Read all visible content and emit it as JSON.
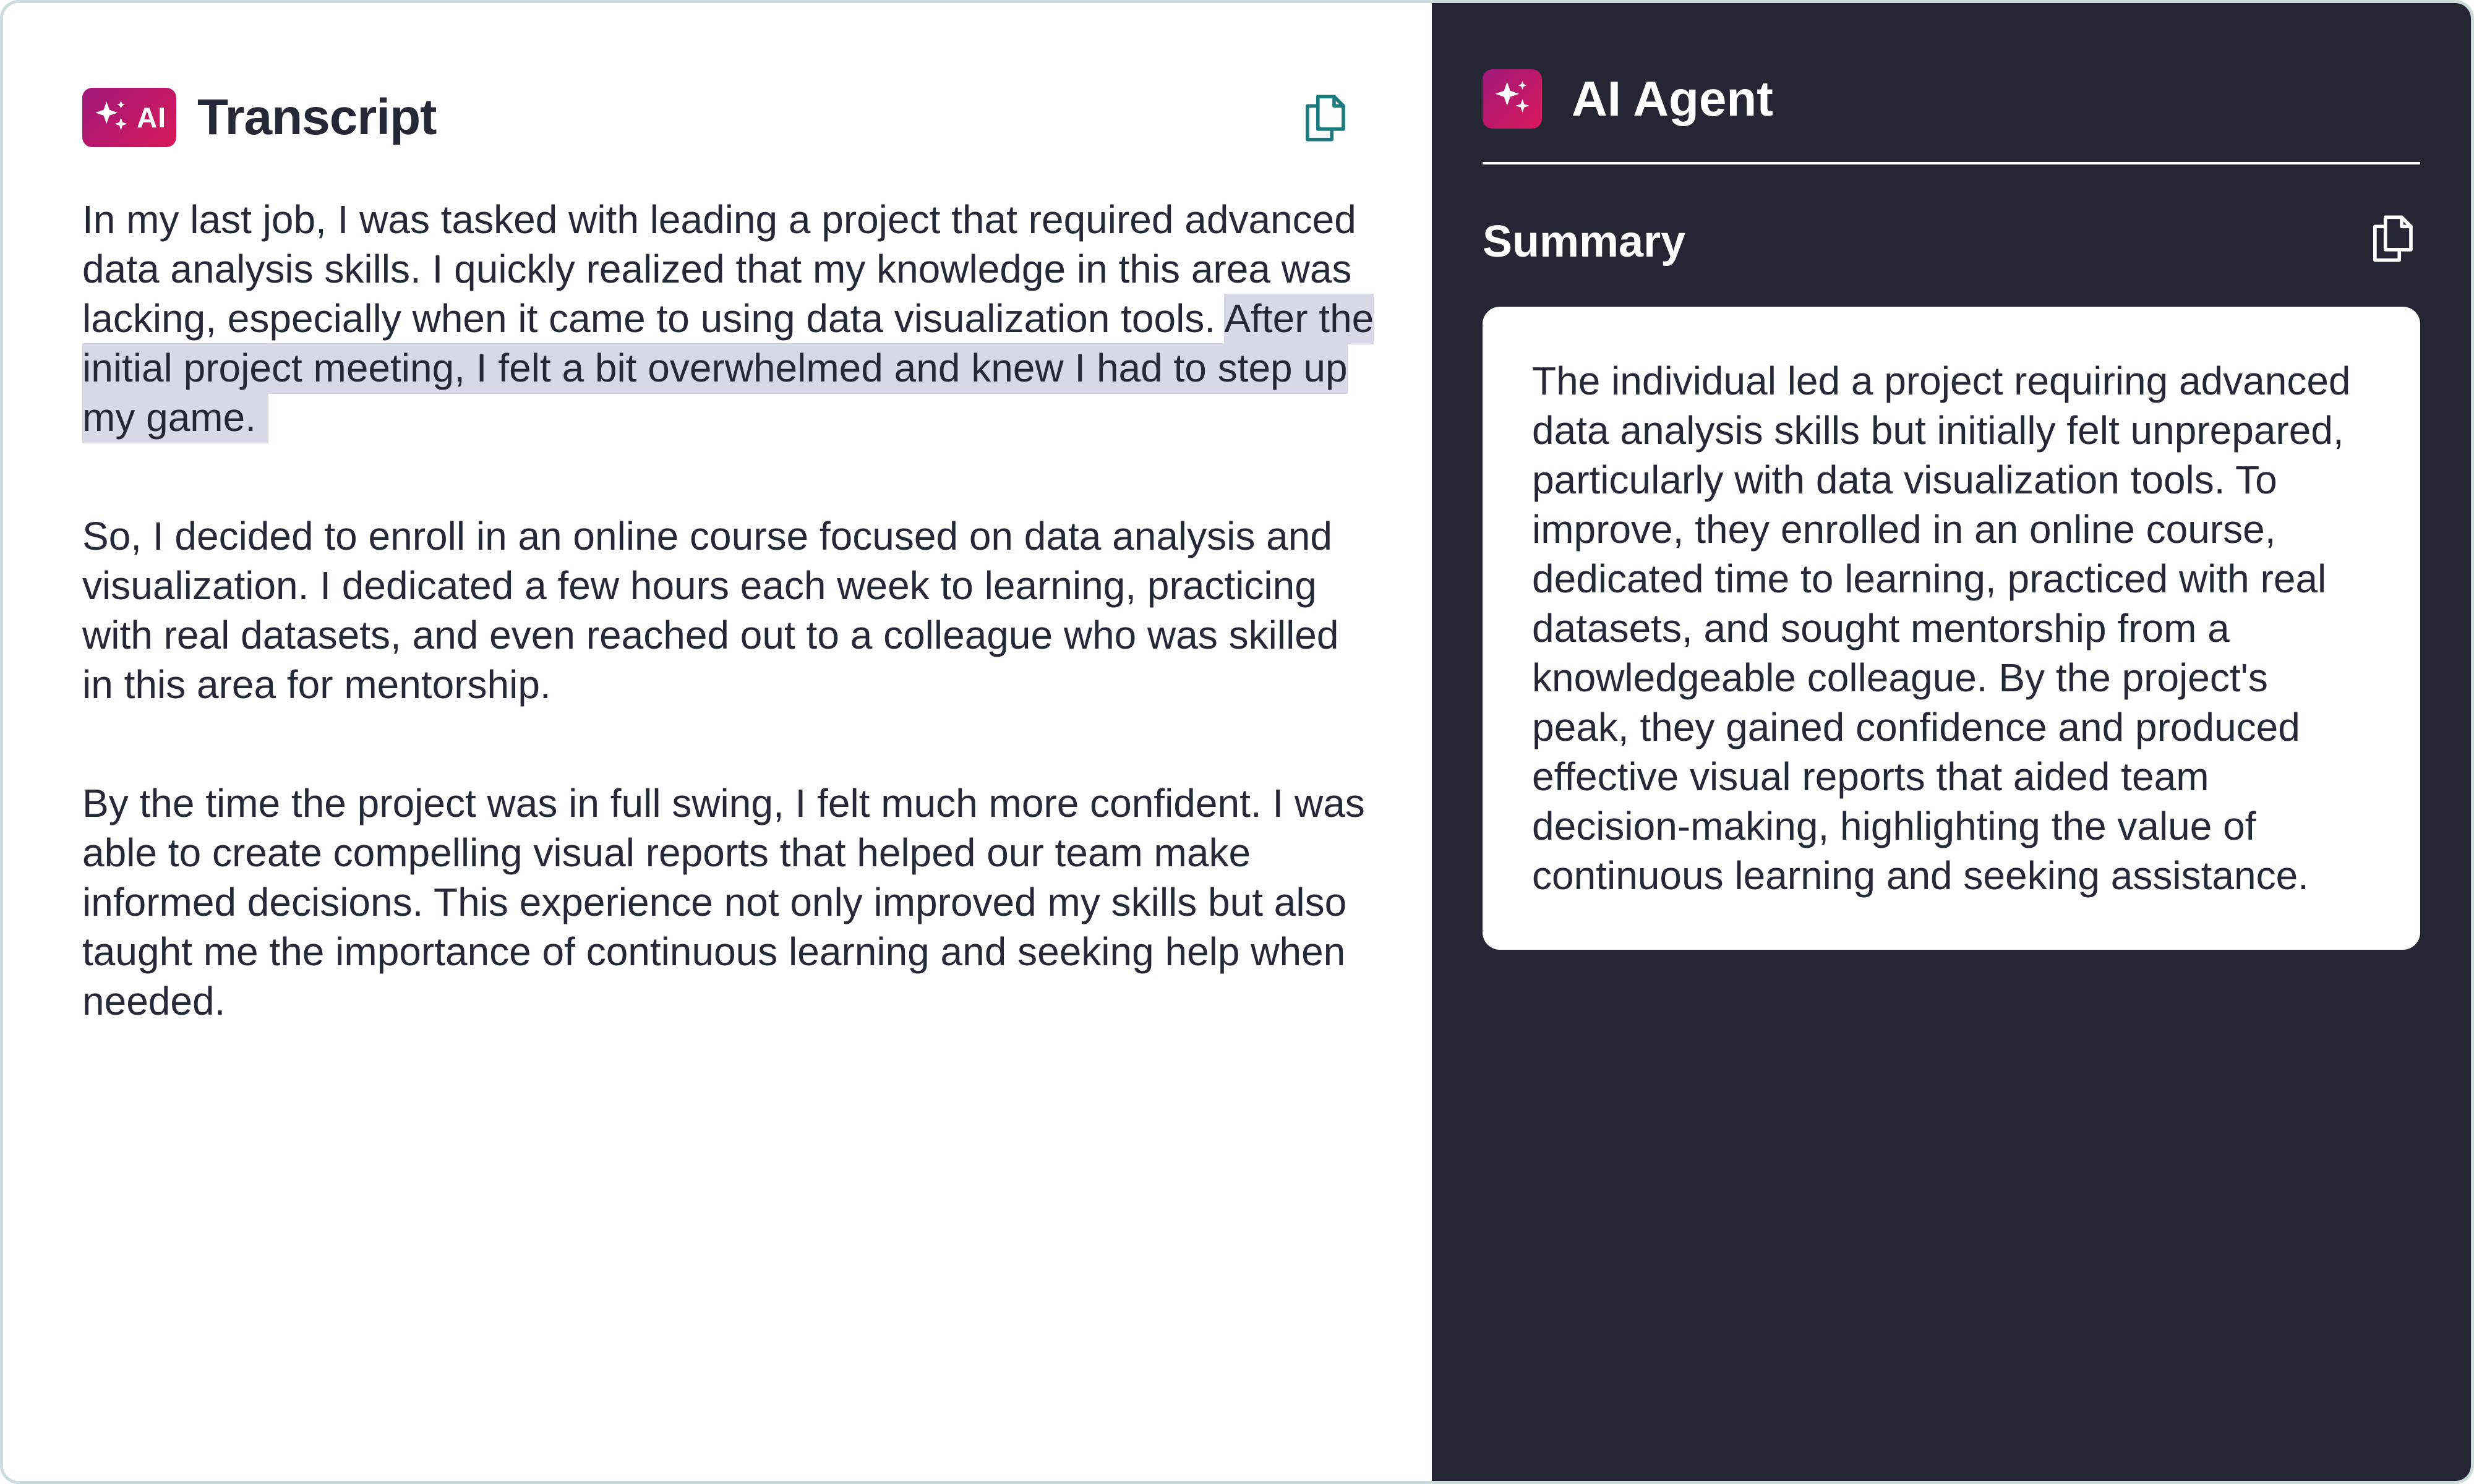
{
  "transcript": {
    "badge_label": "AI",
    "title": "Transcript",
    "paragraphs": {
      "p1_plain": "In my last job, I was tasked with leading a project that required advanced data analysis skills. I quickly realized that my knowledge in this area was lacking, especially when it came to using data visualization tools. ",
      "p1_highlight": "After the initial project meeting, I felt a bit overwhelmed and knew I had to step up my game.",
      "p2": "So, I decided to enroll in an online course focused on data analysis and visualization. I dedicated a few hours each week to learning, practicing with real datasets, and even reached out to a colleague who was skilled in this area for mentorship.",
      "p3": "By the time the project was in full swing, I felt much more confident. I was able to create compelling visual reports that helped our team make informed decisions. This experience not only improved my skills but also taught me the importance of continuous learning and seeking help when needed."
    },
    "highlight_color": "#d6d9e6",
    "copy_icon": "copy-icon",
    "copy_icon_color": "#1b7a7c"
  },
  "agent": {
    "title": "AI Agent",
    "icon": "sparkle-icon",
    "summary": {
      "title": "Summary",
      "copy_icon": "copy-icon",
      "text": "The individual led a project requiring advanced data analysis skills but initially felt unprepared, particularly with data visualization tools. To improve, they enrolled in an online course, dedicated time to learning, practiced with real datasets, and sought mentorship from a knowledgeable colleague. By the project's peak, they gained confidence and produced effective visual reports that aided team decision-making, highlighting the value of continuous learning and seeking assistance."
    },
    "panel_color": "#242633"
  },
  "colors": {
    "brand_gradient_start": "#a0187a",
    "brand_gradient_end": "#d8195a",
    "text_dark": "#252837"
  }
}
